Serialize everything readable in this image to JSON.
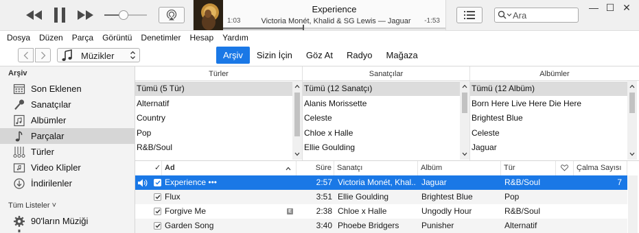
{
  "player": {
    "now_title": "Experience",
    "now_artist": "Victoria Monét, Khalid & SG Lewis — Jaguar",
    "elapsed": "1:03",
    "remaining": "-1:53",
    "progress_fraction": 0.36,
    "volume_fraction": 0.45
  },
  "search": {
    "placeholder": "Ara"
  },
  "window": {
    "minimize": "—",
    "maximize": "☐",
    "close": "✕"
  },
  "menu": [
    "Dosya",
    "Düzen",
    "Parça",
    "Görüntü",
    "Denetimler",
    "Hesap",
    "Yardım"
  ],
  "nav": {
    "media_label": "Müzikler",
    "tabs": [
      {
        "label": "Arşiv",
        "active": true
      },
      {
        "label": "Sizin İçin",
        "active": false
      },
      {
        "label": "Göz At",
        "active": false
      },
      {
        "label": "Radyo",
        "active": false
      },
      {
        "label": "Mağaza",
        "active": false
      }
    ]
  },
  "sidebar": {
    "library_heading": "Arşiv",
    "items": [
      {
        "label": "Son Eklenen",
        "icon": "calendar-grid-icon",
        "active": false
      },
      {
        "label": "Sanatçılar",
        "icon": "microphone-icon",
        "active": false
      },
      {
        "label": "Albümler",
        "icon": "album-icon",
        "active": false
      },
      {
        "label": "Parçalar",
        "icon": "music-note-icon",
        "active": true
      },
      {
        "label": "Türler",
        "icon": "genre-icon",
        "active": false
      },
      {
        "label": "Video Klipler",
        "icon": "video-icon",
        "active": false
      },
      {
        "label": "İndirilenler",
        "icon": "download-icon",
        "active": false
      }
    ],
    "playlists_heading": "Tüm Listeler ˅",
    "playlists": [
      {
        "label": "90'ların Müziği",
        "icon": "gear-icon"
      }
    ]
  },
  "browser": {
    "columns": [
      {
        "header": "Türler",
        "rows": [
          "Tümü (5 Tür)",
          "Alternatif",
          "Country",
          "Pop",
          "R&B/Soul"
        ]
      },
      {
        "header": "Sanatçılar",
        "rows": [
          "Tümü (12 Sanatçı)",
          "Alanis Morissette",
          "Celeste",
          "Chloe x Halle",
          "Ellie Goulding"
        ]
      },
      {
        "header": "Albümler",
        "rows": [
          "Tümü (12 Albüm)",
          "Born Here Live Here Die Here",
          "Brightest Blue",
          "Celeste",
          "Jaguar"
        ]
      }
    ]
  },
  "songs": {
    "headers": {
      "check": "✓",
      "name": "Ad",
      "time": "Süre",
      "artist": "Sanatçı",
      "album": "Albüm",
      "genre": "Tür",
      "plays": "Çalma Sayısı"
    },
    "rows": [
      {
        "name": "Experience •••",
        "time": "2:57",
        "artist": "Victoria Monét, Khal...",
        "album": "Jaguar",
        "genre": "R&B/Soul",
        "plays": "7",
        "playing": true,
        "explicit": false
      },
      {
        "name": "Flux",
        "time": "3:51",
        "artist": "Ellie Goulding",
        "album": "Brightest Blue",
        "genre": "Pop",
        "plays": "",
        "playing": false,
        "explicit": false
      },
      {
        "name": "Forgive Me",
        "time": "2:38",
        "artist": "Chloe x Halle",
        "album": "Ungodly Hour",
        "genre": "R&B/Soul",
        "plays": "",
        "playing": false,
        "explicit": true
      },
      {
        "name": "Garden Song",
        "time": "3:40",
        "artist": "Phoebe Bridgers",
        "album": "Punisher",
        "genre": "Alternatif",
        "plays": "",
        "playing": false,
        "explicit": false
      }
    ]
  },
  "colors": {
    "accent": "#1a78e6",
    "sidebar_bg": "#f3f3f3",
    "selection_gray": "#dcdcdc"
  }
}
